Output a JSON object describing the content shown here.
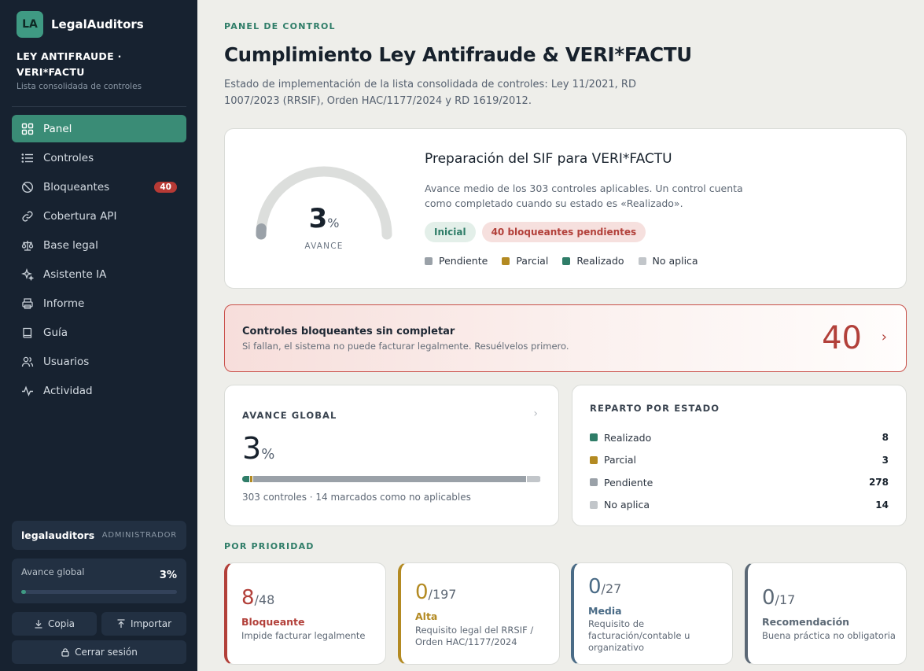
{
  "sidebar": {
    "logo": "LA",
    "brand": "LegalAuditors",
    "project_title": "LEY ANTIFRAUDE · VERI*FACTU",
    "project_subtitle": "Lista consolidada de controles",
    "nav": [
      {
        "label": "Panel",
        "icon": "grid-icon",
        "active": true
      },
      {
        "label": "Controles",
        "icon": "list-icon"
      },
      {
        "label": "Bloqueantes",
        "icon": "ban-icon",
        "badge": "40"
      },
      {
        "label": "Cobertura API",
        "icon": "link-icon"
      },
      {
        "label": "Base legal",
        "icon": "scale-icon"
      },
      {
        "label": "Asistente IA",
        "icon": "sparkle-icon"
      },
      {
        "label": "Informe",
        "icon": "printer-icon"
      },
      {
        "label": "Guía",
        "icon": "book-icon"
      },
      {
        "label": "Usuarios",
        "icon": "users-icon"
      },
      {
        "label": "Actividad",
        "icon": "activity-icon"
      }
    ],
    "user": {
      "name": "legalauditors",
      "role": "ADMINISTRADOR"
    },
    "progress": {
      "label": "Avance global",
      "value": "3%",
      "fraction": 0.03
    },
    "buttons": {
      "copy": "Copia",
      "import": "Importar",
      "logout": "Cerrar sesión"
    }
  },
  "header": {
    "eyebrow": "PANEL DE CONTROL",
    "title": "Cumplimiento Ley Antifraude & VERI*FACTU",
    "description": "Estado de implementación de la lista consolidada de controles: Ley 11/2021, RD 1007/2023 (RRSIF), Orden HAC/1177/2024 y RD 1619/2012."
  },
  "hero": {
    "gauge_value": "3",
    "gauge_unit": "%",
    "gauge_fraction": 0.03,
    "gauge_label": "AVANCE",
    "title": "Preparación del SIF para VERI*FACTU",
    "description": "Avance medio de los 303 controles aplicables. Un control cuenta como completado cuando su estado es «Realizado».",
    "pill_stage": "Inicial",
    "pill_blockers": "40 bloqueantes pendientes",
    "legend": [
      {
        "label": "Pendiente",
        "color": "#9aa1a8"
      },
      {
        "label": "Parcial",
        "color": "#b38a22"
      },
      {
        "label": "Realizado",
        "color": "#2f7d68"
      },
      {
        "label": "No aplica",
        "color": "#c2c6ca"
      }
    ]
  },
  "alert": {
    "title": "Controles bloqueantes sin completar",
    "subtitle": "Si fallan, el sistema no puede facturar legalmente. Resuélvelos primero.",
    "count": "40",
    "chevron": "›"
  },
  "global": {
    "label": "AVANCE GLOBAL",
    "value": "3",
    "unit": "%",
    "chevron": "›",
    "footer": "303 controles · 14 marcados como no aplicables",
    "segments": [
      {
        "status": "Realizado",
        "count": 8,
        "color": "#2f7d68"
      },
      {
        "status": "Parcial",
        "count": 3,
        "color": "#b38a22"
      },
      {
        "status": "Pendiente",
        "count": 278,
        "color": "#9aa1a8"
      },
      {
        "status": "No aplica",
        "count": 14,
        "color": "#c2c6ca"
      }
    ]
  },
  "reparto": {
    "label": "REPARTO POR ESTADO",
    "rows": [
      {
        "label": "Realizado",
        "value": "8",
        "color": "#2f7d68"
      },
      {
        "label": "Parcial",
        "value": "3",
        "color": "#b38a22"
      },
      {
        "label": "Pendiente",
        "value": "278",
        "color": "#9aa1a8"
      },
      {
        "label": "No aplica",
        "value": "14",
        "color": "#c2c6ca"
      }
    ]
  },
  "priority": {
    "label": "POR PRIORIDAD",
    "cards": [
      {
        "done": "8",
        "total": "/48",
        "name": "Bloqueante",
        "desc": "Impide facturar legalmente",
        "color": "#b2403a"
      },
      {
        "done": "0",
        "total": "/197",
        "name": "Alta",
        "desc": "Requisito legal del RRSIF / Orden HAC/1177/2024",
        "color": "#b38a22"
      },
      {
        "done": "0",
        "total": "/27",
        "name": "Media",
        "desc": "Requisito de facturación/contable u organizativo",
        "color": "#4a6b86"
      },
      {
        "done": "0",
        "total": "/17",
        "name": "Recomendación",
        "desc": "Buena práctica no obligatoria",
        "color": "#5b6875"
      }
    ]
  }
}
